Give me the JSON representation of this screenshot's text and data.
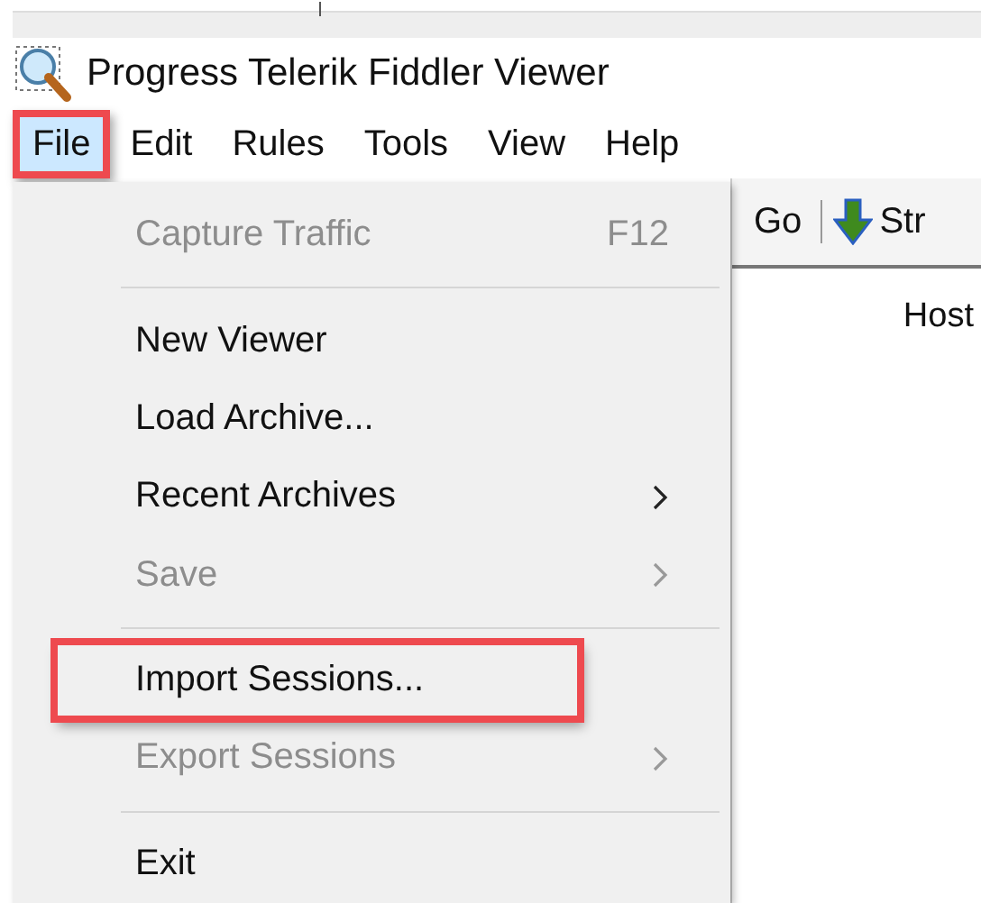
{
  "window": {
    "title": "Progress Telerik Fiddler Viewer"
  },
  "menu_bar": [
    {
      "label": "File",
      "selected": true,
      "highlighted": true
    },
    {
      "label": "Edit",
      "selected": false,
      "highlighted": false
    },
    {
      "label": "Rules",
      "selected": false,
      "highlighted": false
    },
    {
      "label": "Tools",
      "selected": false,
      "highlighted": false
    },
    {
      "label": "View",
      "selected": false,
      "highlighted": false
    },
    {
      "label": "Help",
      "selected": false,
      "highlighted": false
    }
  ],
  "file_menu": [
    {
      "kind": "item",
      "label": "Capture Traffic",
      "shortcut": "F12",
      "disabled": true,
      "submenu": false,
      "highlighted": false
    },
    {
      "kind": "separator"
    },
    {
      "kind": "item",
      "label": "New Viewer",
      "disabled": false,
      "submenu": false,
      "highlighted": false
    },
    {
      "kind": "item",
      "label": "Load Archive...",
      "disabled": false,
      "submenu": false,
      "highlighted": false
    },
    {
      "kind": "item",
      "label": "Recent Archives",
      "disabled": false,
      "submenu": true,
      "highlighted": false
    },
    {
      "kind": "item",
      "label": "Save",
      "disabled": true,
      "submenu": true,
      "highlighted": false
    },
    {
      "kind": "separator"
    },
    {
      "kind": "item",
      "label": "Import Sessions...",
      "disabled": false,
      "submenu": false,
      "highlighted": true
    },
    {
      "kind": "item",
      "label": "Export Sessions",
      "disabled": true,
      "submenu": true,
      "highlighted": false
    },
    {
      "kind": "separator"
    },
    {
      "kind": "item",
      "label": "Exit",
      "disabled": false,
      "submenu": false,
      "highlighted": false
    }
  ],
  "toolbar": {
    "go": "Go",
    "stream": "Str"
  },
  "sessions": {
    "column_1": "Host"
  }
}
